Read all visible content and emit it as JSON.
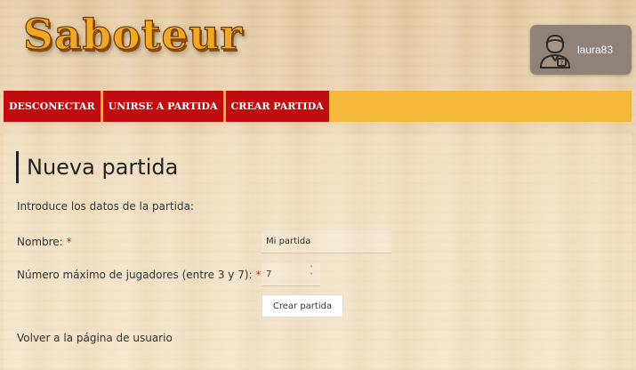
{
  "header": {
    "logo_text": "Saboteur",
    "user": {
      "name": "laura83",
      "icon": "user-avatar-icon"
    }
  },
  "nav": {
    "items": [
      {
        "label": "DESCONECTAR"
      },
      {
        "label": "UNIRSE A PARTIDA"
      },
      {
        "label": "CREAR PARTIDA"
      }
    ]
  },
  "form": {
    "title": "Nueva partida",
    "intro": "Introduce los datos de la partida:",
    "name_label": "Nombre:",
    "name_value": "Mi partida",
    "players_label": "Número máximo de jugadores (entre 3 y 7):",
    "players_value": "7",
    "required_mark": "*",
    "submit_label": "Crear partida"
  },
  "footer_link": {
    "label": "Volver a la página de usuario"
  },
  "colors": {
    "nav_item_bg": "#c10d10",
    "nav_bar_bg": "#f4b83a",
    "logo_fill": "#f4a820",
    "user_box_bg": "#8f8377",
    "required": "#c62828"
  }
}
